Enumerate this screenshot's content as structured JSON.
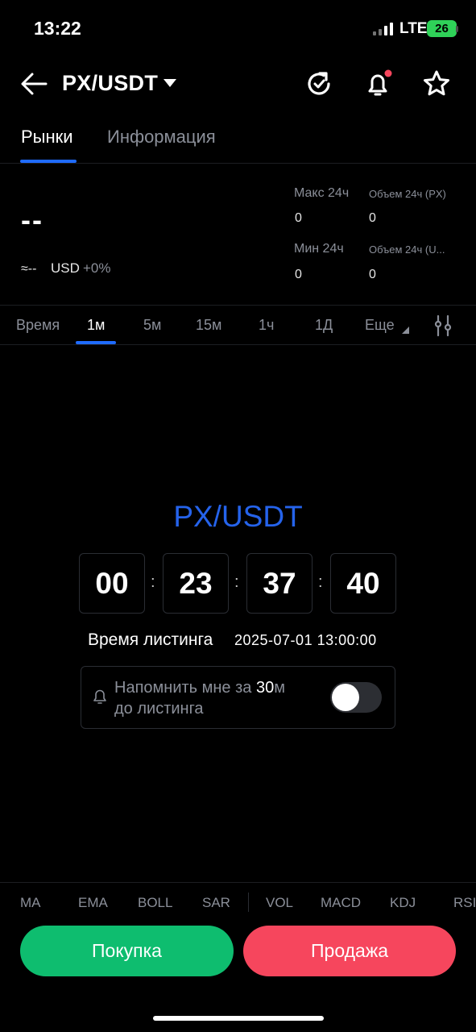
{
  "status_bar": {
    "time": "13:22",
    "network": "LTE",
    "battery": "26"
  },
  "header": {
    "pair": "PX/USDT",
    "icons": [
      "back-arrow-icon",
      "refresh-icon",
      "bell-icon",
      "star-icon"
    ],
    "notification_dot_color": "#f6465d"
  },
  "tabs": [
    {
      "label": "Рынки",
      "active": true
    },
    {
      "label": "Информация",
      "active": false
    }
  ],
  "market": {
    "price": "--",
    "approx": "≈--",
    "currency": "USD",
    "change": "+0%",
    "high_24h": {
      "label": "Макс 24ч",
      "value": "0"
    },
    "vol_24h_px": {
      "label": "Объем 24ч (PX)",
      "value": "0"
    },
    "low_24h": {
      "label": "Мин 24ч",
      "value": "0"
    },
    "vol_24h_u": {
      "label": "Объем 24ч (U...",
      "value": "0"
    }
  },
  "intervals": {
    "items": [
      "Время",
      "1м",
      "5м",
      "15м",
      "1ч",
      "1Д",
      "Еще"
    ],
    "selected": "1м"
  },
  "countdown": {
    "pair": "PX/USDT",
    "days": "00",
    "hours": "23",
    "minutes": "37",
    "seconds": "40",
    "listing_label": "Время листинга",
    "listing_date": "2025-07-01 13:00:00",
    "remind_prefix": "Напомнить мне за ",
    "remind_value": "30",
    "remind_suffix": "м",
    "remind_line2": "до листинга",
    "remind_enabled": false
  },
  "indicators": [
    "MA",
    "EMA",
    "BOLL",
    "SAR",
    "VOL",
    "MACD",
    "KDJ",
    "RSI"
  ],
  "actions": {
    "buy": "Покупка",
    "sell": "Продажа"
  },
  "colors": {
    "accent": "#1f6bff",
    "buy": "#0ebd6f",
    "sell": "#f6465d",
    "title_blue": "#2563eb"
  }
}
